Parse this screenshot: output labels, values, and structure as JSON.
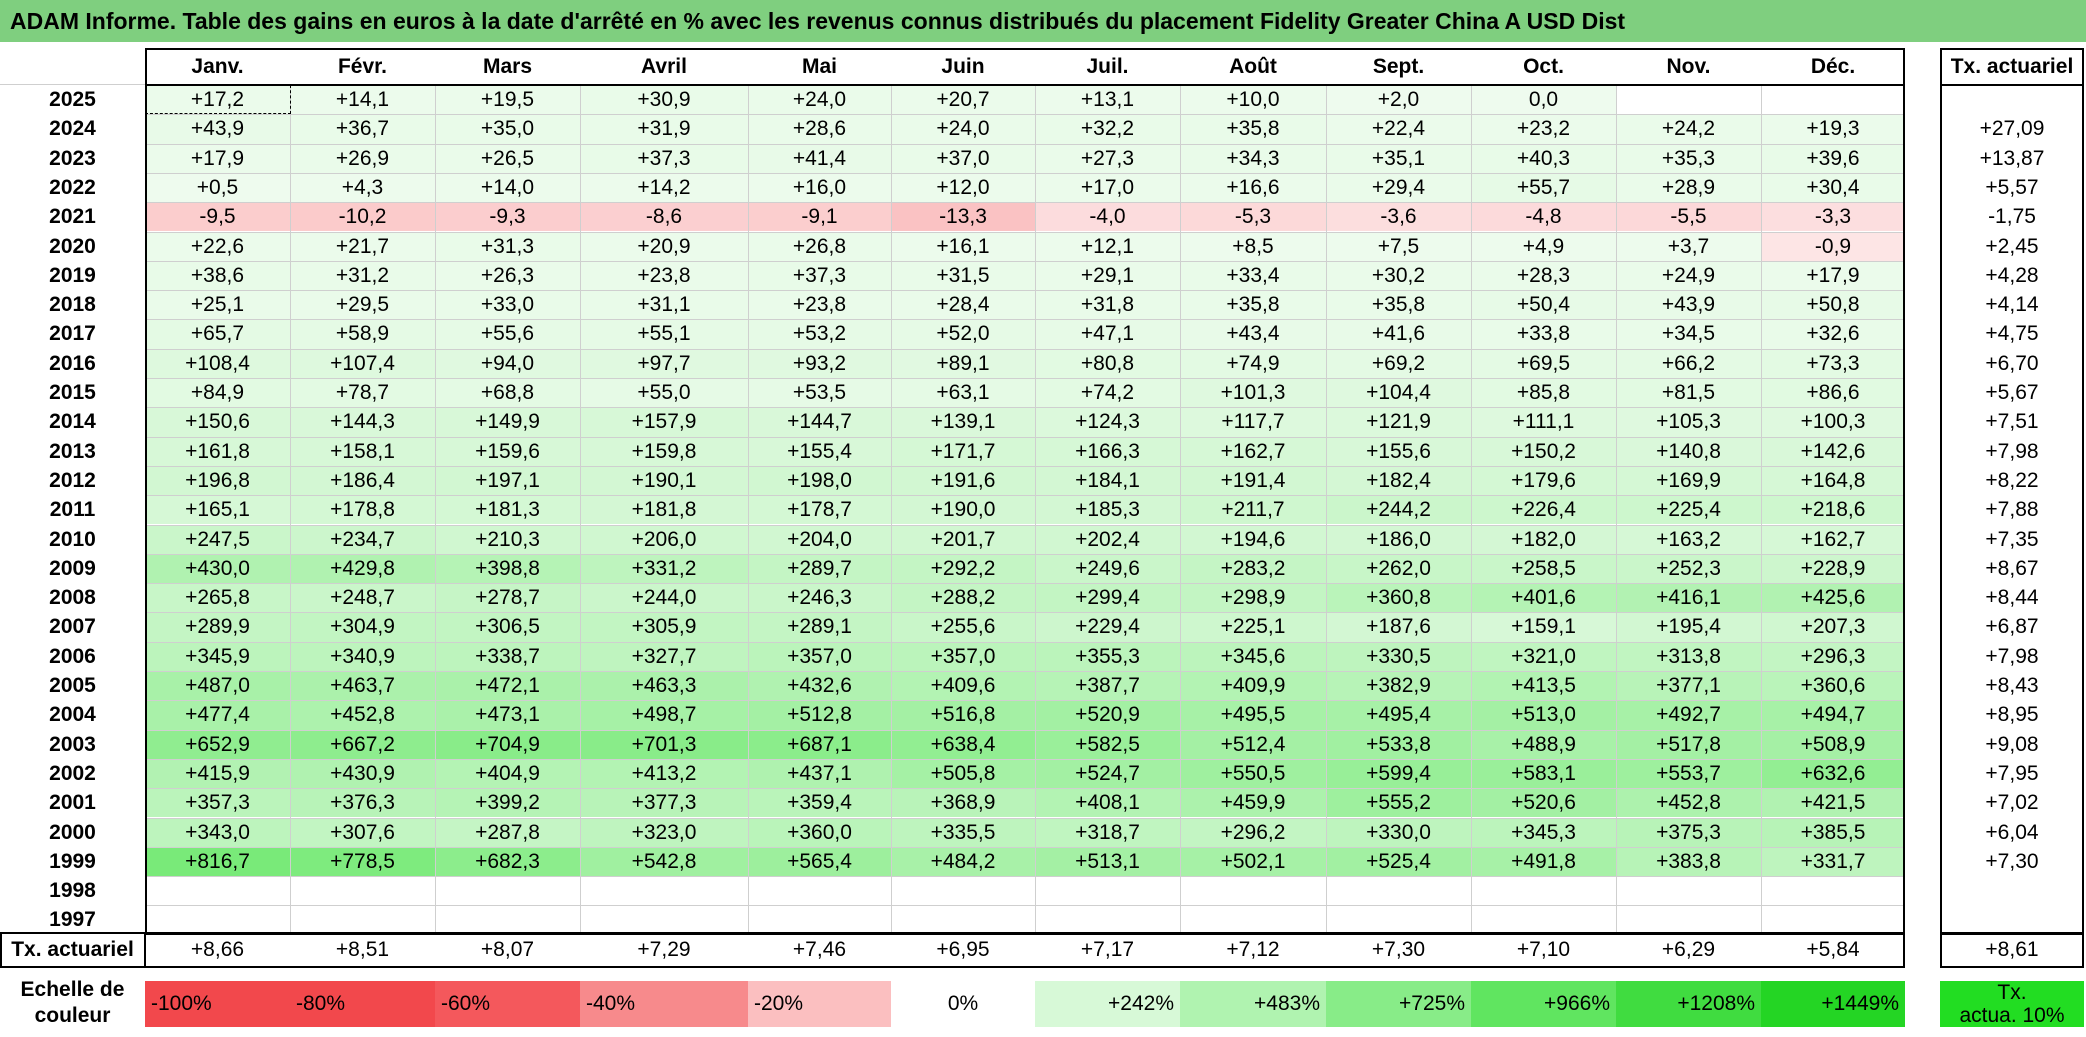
{
  "title": "ADAM Informe. Table des gains en euros à la date d'arrêté en % avec les revenus connus distribués du placement Fidelity Greater China A USD Dist",
  "months": [
    "Janv.",
    "Févr.",
    "Mars",
    "Avril",
    "Mai",
    "Juin",
    "Juil.",
    "Août",
    "Sept.",
    "Oct.",
    "Nov.",
    "Déc."
  ],
  "rate_header": "Tx. actuariel",
  "rows": [
    {
      "year": "2025",
      "values": [
        "+17,2",
        "+14,1",
        "+19,5",
        "+30,9",
        "+24,0",
        "+20,7",
        "+13,1",
        "+10,0",
        "+2,0",
        "0,0",
        "",
        ""
      ],
      "rate": ""
    },
    {
      "year": "2024",
      "values": [
        "+43,9",
        "+36,7",
        "+35,0",
        "+31,9",
        "+28,6",
        "+24,0",
        "+32,2",
        "+35,8",
        "+22,4",
        "+23,2",
        "+24,2",
        "+19,3"
      ],
      "rate": "+27,09"
    },
    {
      "year": "2023",
      "values": [
        "+17,9",
        "+26,9",
        "+26,5",
        "+37,3",
        "+41,4",
        "+37,0",
        "+27,3",
        "+34,3",
        "+35,1",
        "+40,3",
        "+35,3",
        "+39,6"
      ],
      "rate": "+13,87"
    },
    {
      "year": "2022",
      "values": [
        "+0,5",
        "+4,3",
        "+14,0",
        "+14,2",
        "+16,0",
        "+12,0",
        "+17,0",
        "+16,6",
        "+29,4",
        "+55,7",
        "+28,9",
        "+30,4"
      ],
      "rate": "+5,57"
    },
    {
      "year": "2021",
      "values": [
        "-9,5",
        "-10,2",
        "-9,3",
        "-8,6",
        "-9,1",
        "-13,3",
        "-4,0",
        "-5,3",
        "-3,6",
        "-4,8",
        "-5,5",
        "-3,3"
      ],
      "rate": "-1,75"
    },
    {
      "year": "2020",
      "values": [
        "+22,6",
        "+21,7",
        "+31,3",
        "+20,9",
        "+26,8",
        "+16,1",
        "+12,1",
        "+8,5",
        "+7,5",
        "+4,9",
        "+3,7",
        "-0,9"
      ],
      "rate": "+2,45"
    },
    {
      "year": "2019",
      "values": [
        "+38,6",
        "+31,2",
        "+26,3",
        "+23,8",
        "+37,3",
        "+31,5",
        "+29,1",
        "+33,4",
        "+30,2",
        "+28,3",
        "+24,9",
        "+17,9"
      ],
      "rate": "+4,28"
    },
    {
      "year": "2018",
      "values": [
        "+25,1",
        "+29,5",
        "+33,0",
        "+31,1",
        "+23,8",
        "+28,4",
        "+31,8",
        "+35,8",
        "+35,8",
        "+50,4",
        "+43,9",
        "+50,8"
      ],
      "rate": "+4,14"
    },
    {
      "year": "2017",
      "values": [
        "+65,7",
        "+58,9",
        "+55,6",
        "+55,1",
        "+53,2",
        "+52,0",
        "+47,1",
        "+43,4",
        "+41,6",
        "+33,8",
        "+34,5",
        "+32,6"
      ],
      "rate": "+4,75"
    },
    {
      "year": "2016",
      "values": [
        "+108,4",
        "+107,4",
        "+94,0",
        "+97,7",
        "+93,2",
        "+89,1",
        "+80,8",
        "+74,9",
        "+69,2",
        "+69,5",
        "+66,2",
        "+73,3"
      ],
      "rate": "+6,70"
    },
    {
      "year": "2015",
      "values": [
        "+84,9",
        "+78,7",
        "+68,8",
        "+55,0",
        "+53,5",
        "+63,1",
        "+74,2",
        "+101,3",
        "+104,4",
        "+85,8",
        "+81,5",
        "+86,6"
      ],
      "rate": "+5,67"
    },
    {
      "year": "2014",
      "values": [
        "+150,6",
        "+144,3",
        "+149,9",
        "+157,9",
        "+144,7",
        "+139,1",
        "+124,3",
        "+117,7",
        "+121,9",
        "+111,1",
        "+105,3",
        "+100,3"
      ],
      "rate": "+7,51"
    },
    {
      "year": "2013",
      "values": [
        "+161,8",
        "+158,1",
        "+159,6",
        "+159,8",
        "+155,4",
        "+171,7",
        "+166,3",
        "+162,7",
        "+155,6",
        "+150,2",
        "+140,8",
        "+142,6"
      ],
      "rate": "+7,98"
    },
    {
      "year": "2012",
      "values": [
        "+196,8",
        "+186,4",
        "+197,1",
        "+190,1",
        "+198,0",
        "+191,6",
        "+184,1",
        "+191,4",
        "+182,4",
        "+179,6",
        "+169,9",
        "+164,8"
      ],
      "rate": "+8,22"
    },
    {
      "year": "2011",
      "values": [
        "+165,1",
        "+178,8",
        "+181,3",
        "+181,8",
        "+178,7",
        "+190,0",
        "+185,3",
        "+211,7",
        "+244,2",
        "+226,4",
        "+225,4",
        "+218,6"
      ],
      "rate": "+7,88"
    },
    {
      "year": "2010",
      "values": [
        "+247,5",
        "+234,7",
        "+210,3",
        "+206,0",
        "+204,0",
        "+201,7",
        "+202,4",
        "+194,6",
        "+186,0",
        "+182,0",
        "+163,2",
        "+162,7"
      ],
      "rate": "+7,35"
    },
    {
      "year": "2009",
      "values": [
        "+430,0",
        "+429,8",
        "+398,8",
        "+331,2",
        "+289,7",
        "+292,2",
        "+249,6",
        "+283,2",
        "+262,0",
        "+258,5",
        "+252,3",
        "+228,9"
      ],
      "rate": "+8,67"
    },
    {
      "year": "2008",
      "values": [
        "+265,8",
        "+248,7",
        "+278,7",
        "+244,0",
        "+246,3",
        "+288,2",
        "+299,4",
        "+298,9",
        "+360,8",
        "+401,6",
        "+416,1",
        "+425,6"
      ],
      "rate": "+8,44"
    },
    {
      "year": "2007",
      "values": [
        "+289,9",
        "+304,9",
        "+306,5",
        "+305,9",
        "+289,1",
        "+255,6",
        "+229,4",
        "+225,1",
        "+187,6",
        "+159,1",
        "+195,4",
        "+207,3"
      ],
      "rate": "+6,87"
    },
    {
      "year": "2006",
      "values": [
        "+345,9",
        "+340,9",
        "+338,7",
        "+327,7",
        "+357,0",
        "+357,0",
        "+355,3",
        "+345,6",
        "+330,5",
        "+321,0",
        "+313,8",
        "+296,3"
      ],
      "rate": "+7,98"
    },
    {
      "year": "2005",
      "values": [
        "+487,0",
        "+463,7",
        "+472,1",
        "+463,3",
        "+432,6",
        "+409,6",
        "+387,7",
        "+409,9",
        "+382,9",
        "+413,5",
        "+377,1",
        "+360,6"
      ],
      "rate": "+8,43"
    },
    {
      "year": "2004",
      "values": [
        "+477,4",
        "+452,8",
        "+473,1",
        "+498,7",
        "+512,8",
        "+516,8",
        "+520,9",
        "+495,5",
        "+495,4",
        "+513,0",
        "+492,7",
        "+494,7"
      ],
      "rate": "+8,95"
    },
    {
      "year": "2003",
      "values": [
        "+652,9",
        "+667,2",
        "+704,9",
        "+701,3",
        "+687,1",
        "+638,4",
        "+582,5",
        "+512,4",
        "+533,8",
        "+488,9",
        "+517,8",
        "+508,9"
      ],
      "rate": "+9,08"
    },
    {
      "year": "2002",
      "values": [
        "+415,9",
        "+430,9",
        "+404,9",
        "+413,2",
        "+437,1",
        "+505,8",
        "+524,7",
        "+550,5",
        "+599,4",
        "+583,1",
        "+553,7",
        "+632,6"
      ],
      "rate": "+7,95"
    },
    {
      "year": "2001",
      "values": [
        "+357,3",
        "+376,3",
        "+399,2",
        "+377,3",
        "+359,4",
        "+368,9",
        "+408,1",
        "+459,9",
        "+555,2",
        "+520,6",
        "+452,8",
        "+421,5"
      ],
      "rate": "+7,02"
    },
    {
      "year": "2000",
      "values": [
        "+343,0",
        "+307,6",
        "+287,8",
        "+323,0",
        "+360,0",
        "+335,5",
        "+318,7",
        "+296,2",
        "+330,0",
        "+345,3",
        "+375,3",
        "+385,5"
      ],
      "rate": "+6,04"
    },
    {
      "year": "1999",
      "values": [
        "+816,7",
        "+778,5",
        "+682,3",
        "+542,8",
        "+565,4",
        "+484,2",
        "+513,1",
        "+502,1",
        "+525,4",
        "+491,8",
        "+383,8",
        "+331,7"
      ],
      "rate": "+7,30"
    },
    {
      "year": "1998",
      "values": [
        "",
        "",
        "",
        "",
        "",
        "",
        "",
        "",
        "",
        "",
        "",
        ""
      ],
      "rate": ""
    },
    {
      "year": "1997",
      "values": [
        "",
        "",
        "",
        "",
        "",
        "",
        "",
        "",
        "",
        "",
        "",
        ""
      ],
      "rate": ""
    }
  ],
  "footer": {
    "label": "Tx. actuariel",
    "values": [
      "+8,66",
      "+8,51",
      "+8,07",
      "+7,29",
      "+7,46",
      "+6,95",
      "+7,17",
      "+7,12",
      "+7,30",
      "+7,10",
      "+6,29",
      "+5,84"
    ],
    "total": "+8,61"
  },
  "scale": {
    "label_line1": "Echelle de",
    "label_line2": "couleur",
    "steps": [
      {
        "label": "-100%",
        "color": "#f2484c",
        "align": "neg"
      },
      {
        "label": "-80%",
        "color": "#f2484c",
        "align": "neg"
      },
      {
        "label": "-60%",
        "color": "#f4585c",
        "align": "neg"
      },
      {
        "label": "-40%",
        "color": "#f78a8c",
        "align": "neg"
      },
      {
        "label": "-20%",
        "color": "#fbbfc0",
        "align": "neg"
      },
      {
        "label": "0%",
        "color": "#ffffff",
        "align": "center"
      },
      {
        "label": "+242%",
        "color": "#d7f9d7",
        "align": "pos"
      },
      {
        "label": "+483%",
        "color": "#b0f3b0",
        "align": "pos"
      },
      {
        "label": "+725%",
        "color": "#88ec88",
        "align": "pos"
      },
      {
        "label": "+966%",
        "color": "#60e560",
        "align": "pos"
      },
      {
        "label": "+1208%",
        "color": "#40dc40",
        "align": "pos"
      },
      {
        "label": "+1449%",
        "color": "#24d524",
        "align": "pos"
      }
    ],
    "legend_line1": "Tx.",
    "legend_line2": "actua. 10%",
    "legend_color": "#22dd22"
  },
  "colors": {
    "title_bg": "#7fcf7f",
    "positive_max": "#22dd22",
    "negative_max": "#f2484c"
  }
}
